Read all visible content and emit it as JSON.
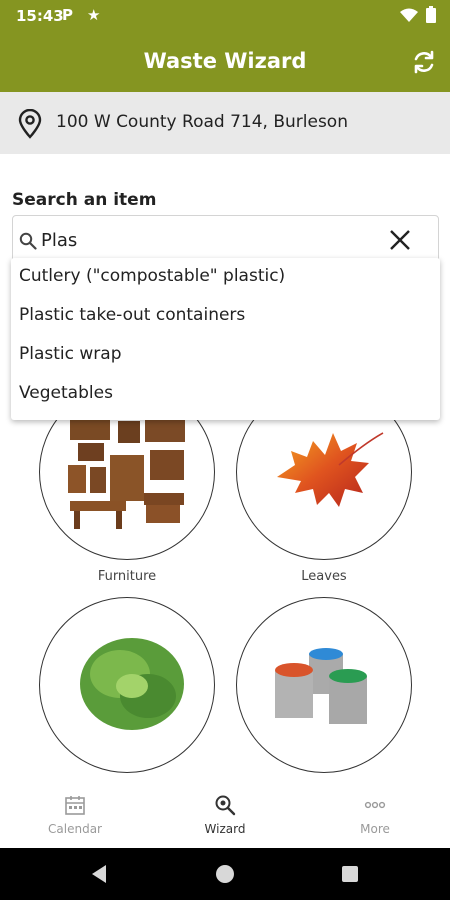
{
  "status_bar": {
    "time": "15:43",
    "left_icons": [
      "parking-icon",
      "star-icon"
    ],
    "right_icons": [
      "wifi-icon",
      "battery-icon"
    ]
  },
  "app_bar": {
    "title": "Waste Wizard",
    "action_icon": "refresh-icon",
    "color": "#859521"
  },
  "address": {
    "icon": "location-pin-icon",
    "text": "100 W County Road 714, Burleson"
  },
  "search": {
    "label": "Search an item",
    "value": "Plas",
    "icon": "search-icon",
    "clear_icon": "close-icon"
  },
  "suggestions": [
    "Cutlery (\"compostable\" plastic)",
    "Plastic take-out containers",
    "Plastic wrap",
    "Vegetables"
  ],
  "categories": [
    {
      "label": "Furniture",
      "image": "furniture-image"
    },
    {
      "label": "Leaves",
      "image": "maple-leaf-image"
    },
    {
      "label": "",
      "image": "grass-clippings-image"
    },
    {
      "label": "",
      "image": "paint-cans-image"
    }
  ],
  "bottom_nav": [
    {
      "label": "Calendar",
      "icon": "calendar-icon",
      "active": false
    },
    {
      "label": "Wizard",
      "icon": "wizard-search-icon",
      "active": true
    },
    {
      "label": "More",
      "icon": "more-dots-icon",
      "active": false
    }
  ],
  "system_nav": [
    "back-icon",
    "home-icon",
    "recents-icon"
  ]
}
